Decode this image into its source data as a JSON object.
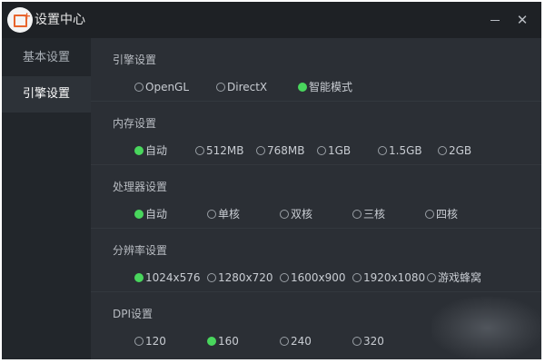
{
  "window": {
    "title": "设置中心"
  },
  "sidebar": {
    "items": [
      {
        "label": "基本设置",
        "active": false
      },
      {
        "label": "引擎设置",
        "active": true
      }
    ]
  },
  "sections": [
    {
      "title": "引擎设置",
      "options": [
        {
          "label": "OpenGL",
          "selected": false
        },
        {
          "label": "DirectX",
          "selected": false
        },
        {
          "label": "智能模式",
          "selected": true
        }
      ]
    },
    {
      "title": "内存设置",
      "options": [
        {
          "label": "自动",
          "selected": true
        },
        {
          "label": "512MB",
          "selected": false
        },
        {
          "label": "768MB",
          "selected": false
        },
        {
          "label": "1GB",
          "selected": false
        },
        {
          "label": "1.5GB",
          "selected": false
        },
        {
          "label": "2GB",
          "selected": false
        }
      ]
    },
    {
      "title": "处理器设置",
      "options": [
        {
          "label": "自动",
          "selected": true
        },
        {
          "label": "单核",
          "selected": false
        },
        {
          "label": "双核",
          "selected": false
        },
        {
          "label": "三核",
          "selected": false
        },
        {
          "label": "四核",
          "selected": false
        }
      ]
    },
    {
      "title": "分辨率设置",
      "options": [
        {
          "label": "1024x576",
          "selected": true
        },
        {
          "label": "1280x720",
          "selected": false
        },
        {
          "label": "1600x900",
          "selected": false
        },
        {
          "label": "1920x1080",
          "selected": false
        },
        {
          "label": "游戏蜂窝",
          "selected": false
        }
      ]
    },
    {
      "title": "DPI设置",
      "options": [
        {
          "label": "120",
          "selected": false
        },
        {
          "label": "160",
          "selected": true
        },
        {
          "label": "240",
          "selected": false
        },
        {
          "label": "320",
          "selected": false
        }
      ]
    }
  ],
  "colors": {
    "accent": "#49d65d",
    "window_bg": "#262a30",
    "content_bg": "#2b2f35"
  },
  "icons": {
    "app": "app-logo-icon",
    "minimize": "minimize-icon",
    "close": "close-icon",
    "radio": "radio-icon"
  }
}
